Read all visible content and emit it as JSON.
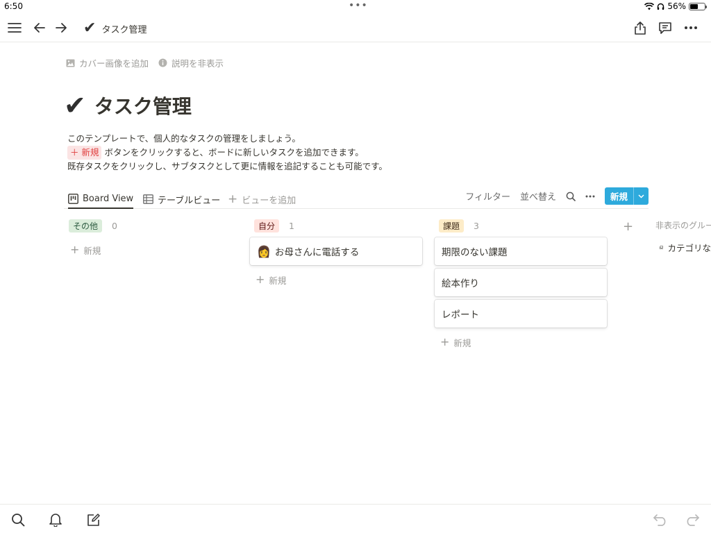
{
  "status_bar": {
    "time": "6:50",
    "battery": "56%",
    "battery_level": 0.56
  },
  "toolbar": {
    "page_icon": "check-mark-icon",
    "title": "タスク管理"
  },
  "page_controls": {
    "add_cover": "カバー画像を追加",
    "hide_description": "説明を非表示"
  },
  "page": {
    "title": "タスク管理",
    "description": {
      "line1": "このテンプレートで、個人的なタスクの管理をしましょう。",
      "new_tag": "＋ 新規",
      "line2": "ボタンをクリックすると、ボードに新しいタスクを追加できます。",
      "line3": "既存タスクをクリックし、サブタスクとして更に情報を追記することも可能です。"
    }
  },
  "views": {
    "tabs": [
      {
        "label": "Board View",
        "icon": "board-icon"
      },
      {
        "label": "テーブルビュー",
        "icon": "table-icon"
      }
    ],
    "add_view": "ビューを追加",
    "filter": "フィルター",
    "sort": "並べ替え",
    "new_button": "新規"
  },
  "board": {
    "columns": [
      {
        "label": "その他",
        "count": "0",
        "color_bg": "#dbeddb",
        "color_fg": "#2b593f",
        "cards": []
      },
      {
        "label": "自分",
        "count": "1",
        "color_bg": "#ffe2dd",
        "color_fg": "#5d1715",
        "cards": [
          {
            "emoji": "👩",
            "title": "お母さんに電話する"
          }
        ]
      },
      {
        "label": "課題",
        "count": "3",
        "color_bg": "#fdecc8",
        "color_fg": "#402c1b",
        "cards": [
          {
            "title": "期限のない課題"
          },
          {
            "title": "絵本作り"
          },
          {
            "title": "レポート"
          }
        ]
      }
    ],
    "add_new_label": "新規",
    "hidden_groups": "非表示のグループ",
    "hidden_category": "カテゴリな"
  },
  "colors": {
    "accent": "#2eaadc"
  }
}
